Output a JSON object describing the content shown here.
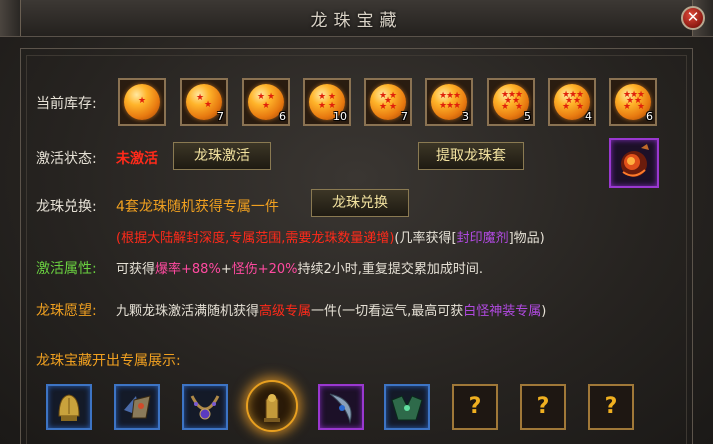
{
  "window": {
    "title": "龙珠宝藏",
    "close_label": "✕"
  },
  "inventory": {
    "label": "当前库存:",
    "orbs": [
      {
        "stars": 1,
        "count": ""
      },
      {
        "stars": 2,
        "count": "7"
      },
      {
        "stars": 3,
        "count": "6"
      },
      {
        "stars": 4,
        "count": "10"
      },
      {
        "stars": 5,
        "count": "7"
      },
      {
        "stars": 6,
        "count": "3"
      },
      {
        "stars": 7,
        "count": "5"
      },
      {
        "stars": 7,
        "count": "4"
      },
      {
        "stars": 7,
        "count": "6"
      }
    ]
  },
  "activation": {
    "label": "激活状态:",
    "status": "未激活",
    "status_color": "#ff2a1a",
    "activate_button": "龙珠激活",
    "extract_button": "提取龙珠套"
  },
  "exchange": {
    "label": "龙珠兑换:",
    "text": "4套龙珠随机获得专属一件",
    "button": "龙珠兑换",
    "note_red": "(根据大陆解封深度,专属范围,需要龙珠数量递增)",
    "note_mid": "(几率获得[",
    "note_purple": "封印魔剂",
    "note_end": "]物品)"
  },
  "attribute": {
    "label": "激活属性:",
    "p1": "可获得",
    "p2": "爆率+88%",
    "p3": "+",
    "p4": "怪伤+20%",
    "p5": "持续2小时,重复提交累加成时间."
  },
  "wish": {
    "label": "龙珠愿望:",
    "p1": "九颗龙珠激活满随机获得",
    "p2": "高级专属",
    "p3": "一件(一切看运气,最高可获",
    "p4": "白怪神装专属",
    "p5": ")"
  },
  "showcase": {
    "label": "龙珠宝藏开出专属展示:",
    "unknown_mark": "?"
  },
  "colors": {
    "gold": "#f0a020",
    "green": "#6ad040",
    "red": "#ff2a1a",
    "pink": "#ff4aa0",
    "purple": "#b04ae0",
    "light": "#e6e1d6"
  }
}
